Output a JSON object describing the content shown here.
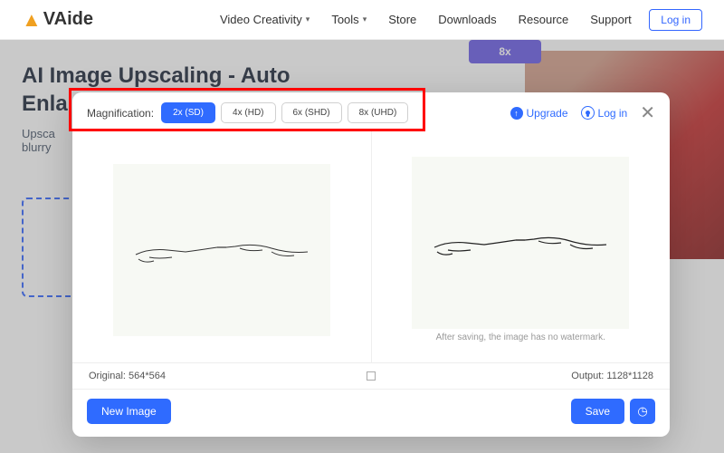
{
  "header": {
    "logo_text": "VAide",
    "nav": {
      "video_creativity": "Video Creativity",
      "tools": "Tools",
      "store": "Store",
      "downloads": "Downloads",
      "resource": "Resource",
      "support": "Support"
    },
    "login": "Log in"
  },
  "background": {
    "title_line1": "AI Image Upscaling - Auto",
    "title_line2": "Enla",
    "subtitle_line1": "Upsca",
    "subtitle_line2": "blurry",
    "badge": "8x"
  },
  "modal": {
    "magnification_label": "Magnification:",
    "options": {
      "opt1": "2x (SD)",
      "opt2": "4x (HD)",
      "opt3": "6x (SHD)",
      "opt4": "8x (UHD)"
    },
    "upgrade": "Upgrade",
    "login": "Log in",
    "watermark_note": "After saving, the image has no watermark.",
    "original_label": "Original: 564*564",
    "output_label": "Output: 1128*1128",
    "new_image": "New Image",
    "save": "Save"
  }
}
